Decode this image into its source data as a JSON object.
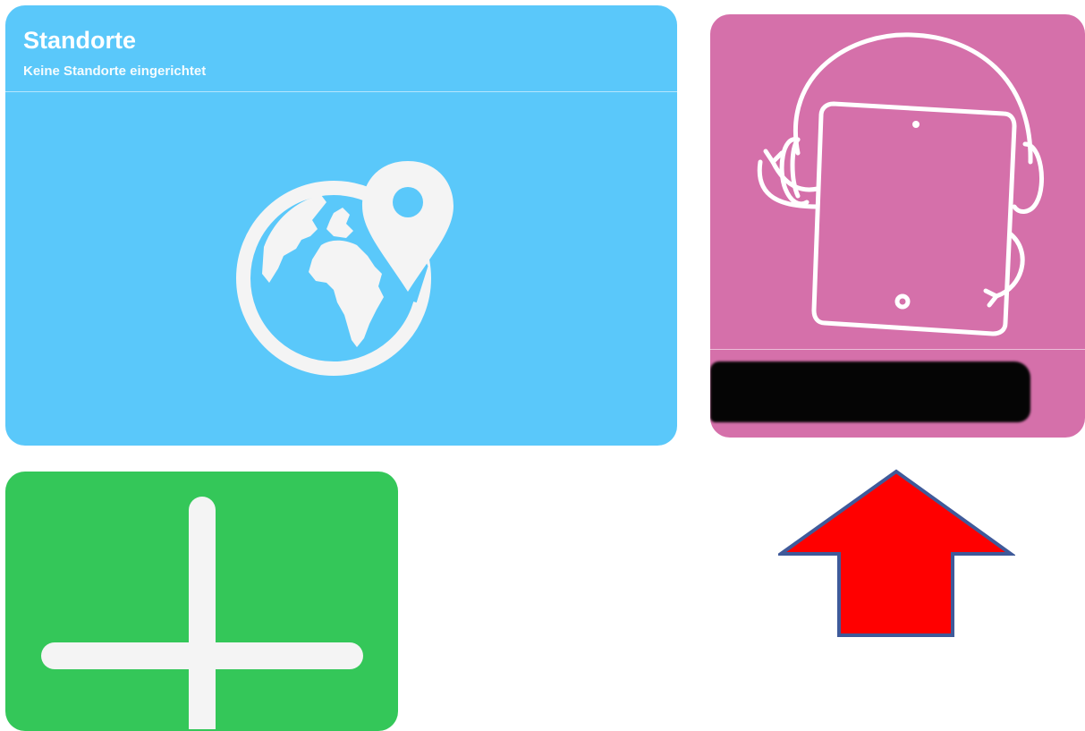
{
  "locations_card": {
    "title": "Standorte",
    "subtitle": "Keine Standorte eingerichtet",
    "icon": "globe-location-pin-icon",
    "color": "#5ac8fa"
  },
  "ipad_card": {
    "icon": "ipad-with-headphones-illustration",
    "label_redacted": true,
    "color": "#d570aa"
  },
  "add_card": {
    "icon": "plus-icon",
    "color": "#34c759"
  },
  "annotation": {
    "icon": "red-arrow-up-icon",
    "color": "#ff0000",
    "outline_color": "#3f5a9a"
  }
}
